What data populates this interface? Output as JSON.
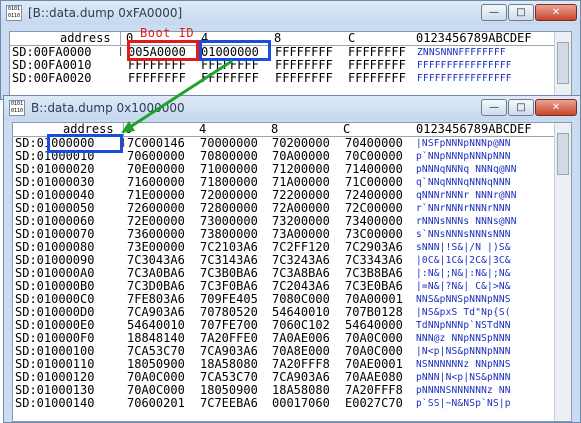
{
  "back_window": {
    "title": "[B::data.dump 0xFA0000]",
    "icon_text": "0101\n0110",
    "columns": [
      "address",
      "0",
      "4",
      "8",
      "C",
      "0123456789ABCDEF"
    ],
    "rows": [
      {
        "addr": "SD:00FA0000",
        "c0": "005A0000",
        "c4": "01000000",
        "c8": "FFFFFFFF",
        "cc": "FFFFFFFF",
        "ascii": "ZNNSNNNFFFFFFFF",
        "marker": "|"
      },
      {
        "addr": "SD:00FA0010",
        "c0": "FFFFFFFF",
        "c4": "FFFFFFFF",
        "c8": "FFFFFFFF",
        "cc": "FFFFFFFF",
        "ascii": "FFFFFFFFFFFFFFFF",
        "marker": ""
      },
      {
        "addr": "SD:00FA0020",
        "c0": "FFFFFFFF",
        "c4": "FFFFFFFF",
        "c8": "FFFFFFFF",
        "cc": "FFFFFFFF",
        "ascii": "FFFFFFFFFFFFFFFF",
        "marker": ""
      }
    ],
    "controls": {
      "min": "—",
      "max": "□",
      "close": "✕"
    }
  },
  "annotation": {
    "boot_id": "Boot ID"
  },
  "front_window": {
    "title": "B::data.dump 0x1000000",
    "icon_text": "0101\n0110",
    "columns": [
      "address",
      "0",
      "4",
      "8",
      "C",
      "0123456789ABCDEF"
    ],
    "rows": [
      {
        "addr": "SD:01000000",
        "c0": "7C000146",
        "c4": "70000000",
        "c8": "70200000",
        "cc": "70400000",
        "ascii": "|NSFpNNNpNNNp@NN",
        "marker": "|"
      },
      {
        "addr": "SD:01000010",
        "c0": "70600000",
        "c4": "70800000",
        "c8": "70A00000",
        "cc": "70C00000",
        "ascii": "p`NNpNNNpNNNpNNN",
        "marker": ""
      },
      {
        "addr": "SD:01000020",
        "c0": "70E00000",
        "c4": "71000000",
        "c8": "71200000",
        "cc": "71400000",
        "ascii": "pNNNqNNNq NNNq@NN",
        "marker": ""
      },
      {
        "addr": "SD:01000030",
        "c0": "71600000",
        "c4": "71800000",
        "c8": "71A00000",
        "cc": "71C00000",
        "ascii": "q`NNqNNNqNNNqNNN",
        "marker": ""
      },
      {
        "addr": "SD:01000040",
        "c0": "71E00000",
        "c4": "72000000",
        "c8": "72200000",
        "cc": "72400000",
        "ascii": "qNNNrNNNr NNNr@NN",
        "marker": ""
      },
      {
        "addr": "SD:01000050",
        "c0": "72600000",
        "c4": "72800000",
        "c8": "72A00000",
        "cc": "72C00000",
        "ascii": "r`NNrNNNrNNNrNNN",
        "marker": ""
      },
      {
        "addr": "SD:01000060",
        "c0": "72E00000",
        "c4": "73000000",
        "c8": "73200000",
        "cc": "73400000",
        "ascii": "rNNNsNNNs NNNs@NN",
        "marker": ""
      },
      {
        "addr": "SD:01000070",
        "c0": "73600000",
        "c4": "73800000",
        "c8": "73A00000",
        "cc": "73C00000",
        "ascii": "s`NNsNNNsNNNsNNN",
        "marker": ""
      },
      {
        "addr": "SD:01000080",
        "c0": "73E00000",
        "c4": "7C2103A6",
        "c8": "7C2FF120",
        "cc": "7C2903A6",
        "ascii": "sNNN|!S&|/N |)S&",
        "marker": ""
      },
      {
        "addr": "SD:01000090",
        "c0": "7C3043A6",
        "c4": "7C3143A6",
        "c8": "7C3243A6",
        "cc": "7C3343A6",
        "ascii": "|0C&|1C&|2C&|3C&",
        "marker": ""
      },
      {
        "addr": "SD:010000A0",
        "c0": "7C3A0BA6",
        "c4": "7C3B0BA6",
        "c8": "7C3A8BA6",
        "cc": "7C3B8BA6",
        "ascii": "|:N&|;N&|:N&|;N&",
        "marker": ""
      },
      {
        "addr": "SD:010000B0",
        "c0": "7C3D0BA6",
        "c4": "7C3F0BA6",
        "c8": "7C2043A6",
        "cc": "7C3E0BA6",
        "ascii": "|=N&|?N&| C&|>N&",
        "marker": ""
      },
      {
        "addr": "SD:010000C0",
        "c0": "7FE803A6",
        "c4": "709FE405",
        "c8": "7080C000",
        "cc": "70A00001",
        "ascii": "NNS&pNNSpNNNpNNS",
        "marker": ""
      },
      {
        "addr": "SD:010000D0",
        "c0": "7CA903A6",
        "c4": "70780520",
        "c8": "54640010",
        "cc": "707B0128",
        "ascii": "|NS&pxS Td\"Np{S(",
        "marker": ""
      },
      {
        "addr": "SD:010000E0",
        "c0": "54640010",
        "c4": "707FE700",
        "c8": "7060C102",
        "cc": "54640000",
        "ascii": "TdNNpNNNp`NSTdNN",
        "marker": ""
      },
      {
        "addr": "SD:010000F0",
        "c0": "18848140",
        "c4": "7A20FFE0",
        "c8": "7A0AE006",
        "cc": "70A0C000",
        "ascii": "NNN@z NNpNNSpNNN",
        "marker": ""
      },
      {
        "addr": "SD:01000100",
        "c0": "7CA53C70",
        "c4": "7CA903A6",
        "c8": "70A8E000",
        "cc": "70A0C000",
        "ascii": "|N<p|NS&pNNNpNNN",
        "marker": ""
      },
      {
        "addr": "SD:01000110",
        "c0": "18050900",
        "c4": "18A58080",
        "c8": "7A20FFF8",
        "cc": "70AE0001",
        "ascii": "NSNNNNNNz NNpNNS",
        "marker": ""
      },
      {
        "addr": "SD:01000120",
        "c0": "70A0C000",
        "c4": "7CA53C70",
        "c8": "7CA903A6",
        "cc": "70AAE080",
        "ascii": "pNNN|N<p|NS&pNNN",
        "marker": ""
      },
      {
        "addr": "SD:01000130",
        "c0": "70A0C000",
        "c4": "18050900",
        "c8": "18A58080",
        "cc": "7A20FFF8",
        "ascii": "pNNNNSNNNNNNz NN",
        "marker": ""
      },
      {
        "addr": "SD:01000140",
        "c0": "70600201",
        "c4": "7C7EEBA6",
        "c8": "00017060",
        "cc": "E0027C70",
        "ascii": "p`SS|~N&NSp`NS|p",
        "marker": ""
      }
    ],
    "controls": {
      "min": "—",
      "max": "□",
      "close": "✕"
    }
  }
}
